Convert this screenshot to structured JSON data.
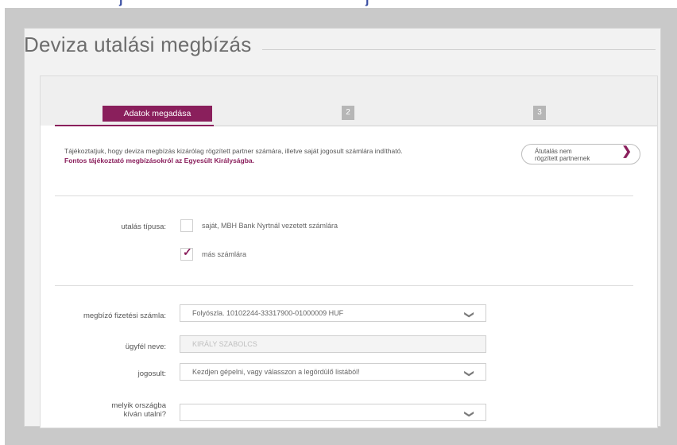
{
  "page": {
    "title": "Deviza utalási megbízás"
  },
  "steps": [
    {
      "label": "Adatok megadása",
      "state": "active"
    },
    {
      "label": "2",
      "state": "inactive"
    },
    {
      "label": "3",
      "state": "inactive"
    }
  ],
  "info": {
    "text": "Tájékoztatjuk, hogy deviza megbízás kizárólag rögzített partner számára, illetve saját jogosult számlára indítható.",
    "link": "Fontos tájékoztató megbízásokról az Egyesült Királyságba."
  },
  "partner_button": {
    "line1": "Átutalás nem",
    "line2": "rögzített partnernek"
  },
  "transfer_type": {
    "label": "utalás típusa:",
    "options": [
      {
        "label": "saját, MBH Bank Nyrtnál vezetett számlára",
        "checked": false
      },
      {
        "label": "más számlára",
        "checked": true
      }
    ]
  },
  "form": {
    "payer_account": {
      "label": "megbízó fizetési számla:",
      "value": "Folyószla. 10102244-33317900-01000009 HUF"
    },
    "client_name": {
      "label": "ügyfél neve:",
      "value": "KIRÁLY SZABOLCS"
    },
    "beneficiary": {
      "label": "jogosult:",
      "value": "Kezdjen gépelni, vagy válasszon a legördülő listából!"
    },
    "country": {
      "label_line1": "melyik országba",
      "label_line2": "kíván utalni?",
      "value": ""
    }
  },
  "colors": {
    "accent": "#8a1f5c",
    "background_gray": "#c9c9c9"
  },
  "icons": {
    "dropdown": "chevron-down-icon",
    "check": "check-icon",
    "next": "chevron-right-icon"
  }
}
